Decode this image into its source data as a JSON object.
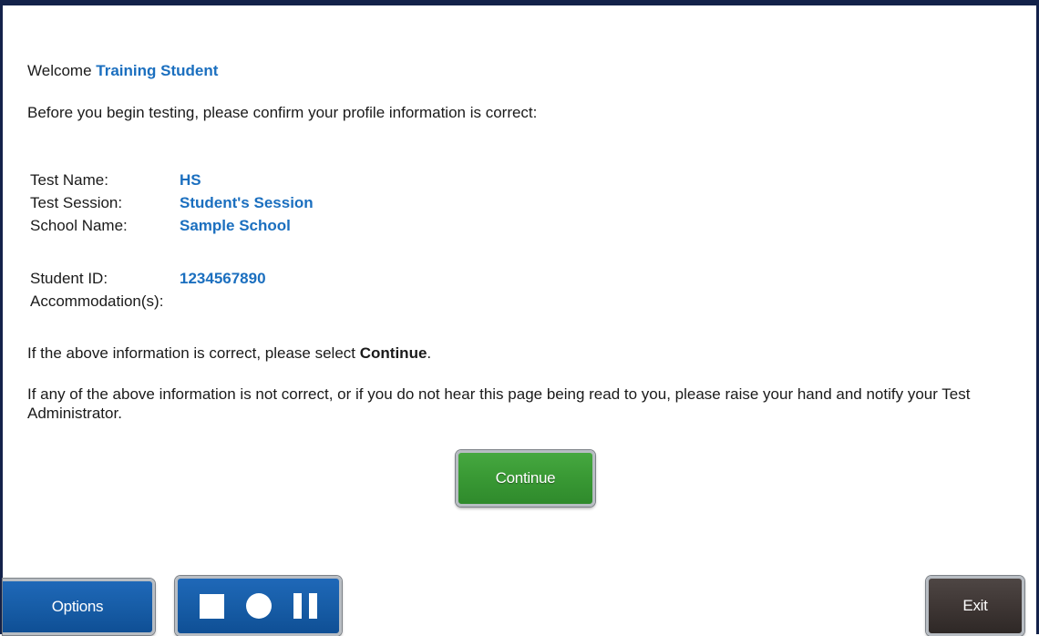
{
  "welcome": {
    "prefix": "Welcome",
    "student_name": "Training Student"
  },
  "intro_text": "Before you begin testing, please confirm your profile information is correct:",
  "profile": [
    {
      "label": "Test Name:",
      "value": "HS"
    },
    {
      "label": "Test Session:",
      "value": "Student's Session"
    },
    {
      "label": "School Name:",
      "value": "Sample School"
    }
  ],
  "student": [
    {
      "label": "Student ID:",
      "value": "1234567890"
    },
    {
      "label": "Accommodation(s):",
      "value": ""
    }
  ],
  "confirm": {
    "prefix": "If the above information is correct, please select ",
    "bold": "Continue",
    "suffix": "."
  },
  "warning_text": "If any of the above information is not correct, or if you do not hear this page being read to you, please raise your hand and notify your Test Administrator.",
  "buttons": {
    "continue_label": "Continue",
    "options_label": "Options",
    "exit_label": "Exit"
  },
  "media_controls": {
    "stop_icon": "stop-icon",
    "record_icon": "record-icon",
    "pause_icon": "pause-icon"
  },
  "colors": {
    "accent_blue": "#1b6fbf",
    "frame_navy": "#13224a",
    "continue_green": "#3a9a35",
    "options_blue": "#175da7",
    "exit_dark": "#3d3533"
  }
}
